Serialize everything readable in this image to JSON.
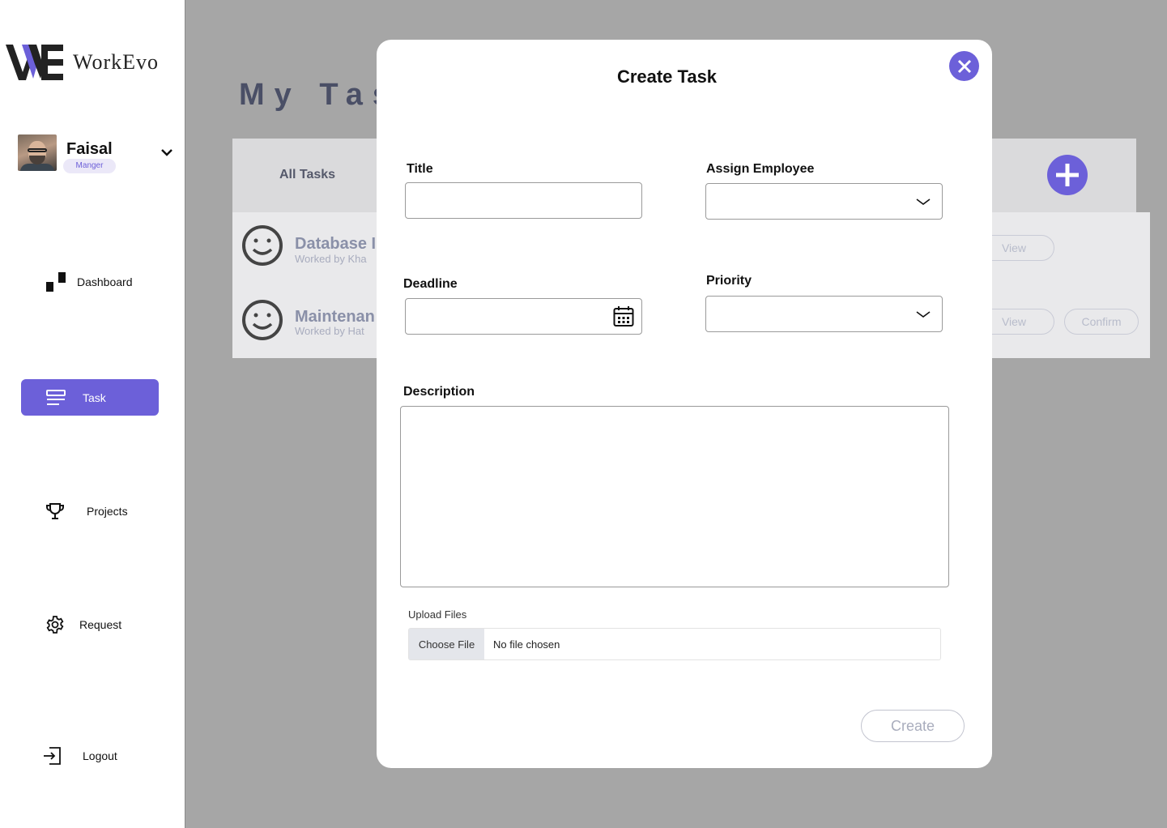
{
  "brand": {
    "name": "WorkEvo",
    "logo_mark": "WE"
  },
  "profile": {
    "name": "Faisal",
    "role": "Manger"
  },
  "nav": [
    {
      "label": "Dashboard",
      "icon": "dashboard-icon",
      "active": false
    },
    {
      "label": "Task",
      "icon": "task-list-icon",
      "active": true
    },
    {
      "label": "Projects",
      "icon": "trophy-icon",
      "active": false
    },
    {
      "label": "Request",
      "icon": "gear-icon",
      "active": false
    },
    {
      "label": "Logout",
      "icon": "logout-icon",
      "active": false
    }
  ],
  "page": {
    "title": "My Tas",
    "tab_all": "All Tasks",
    "tasks": [
      {
        "title": "Database I",
        "subtitle": "Worked by Kha",
        "view": "View"
      },
      {
        "title": "Maintenan",
        "subtitle": "Worked by Hat",
        "view": "View",
        "confirm": "Confirm"
      }
    ]
  },
  "modal": {
    "title": "Create Task",
    "fields": {
      "title_label": "Title",
      "assign_label": "Assign Employee",
      "deadline_label": "Deadline",
      "priority_label": "Priority",
      "description_label": "Description",
      "upload_label": "Upload Files",
      "choose_file": "Choose File",
      "no_file": "No file chosen"
    },
    "create_label": "Create"
  },
  "colors": {
    "accent": "#6c60d9",
    "overlay": "#a6a6a6",
    "muted_text": "#8a90a8"
  }
}
